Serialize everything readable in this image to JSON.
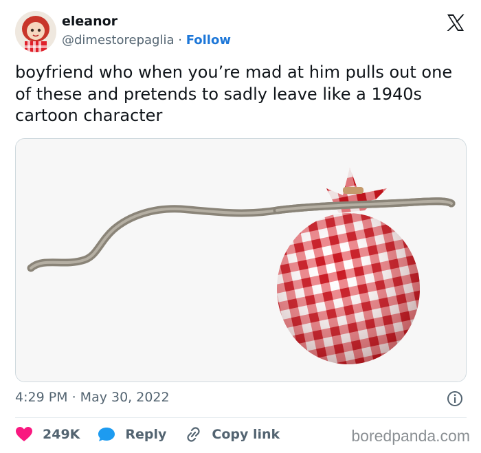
{
  "author": {
    "name": "eleanor",
    "handle": "@dimestorepaglia",
    "separator": "·",
    "follow_label": "Follow",
    "avatar_icon": "doll-avatar"
  },
  "platform_icon": "x-logo-icon",
  "tweet": {
    "text": "boyfriend who when you’re mad at him pulls out one of these and pretends to sadly leave like a 1940s cartoon character",
    "media_icon": "bindle-photo"
  },
  "timestamp": "4:29 PM · May 30, 2022",
  "actions": {
    "likes": "249K",
    "reply_label": "Reply",
    "copy_label": "Copy link"
  },
  "watermark": "boredpanda.com",
  "colors": {
    "accent": "#1d77d8",
    "like": "#f91880",
    "gingham": "#e0202a"
  }
}
